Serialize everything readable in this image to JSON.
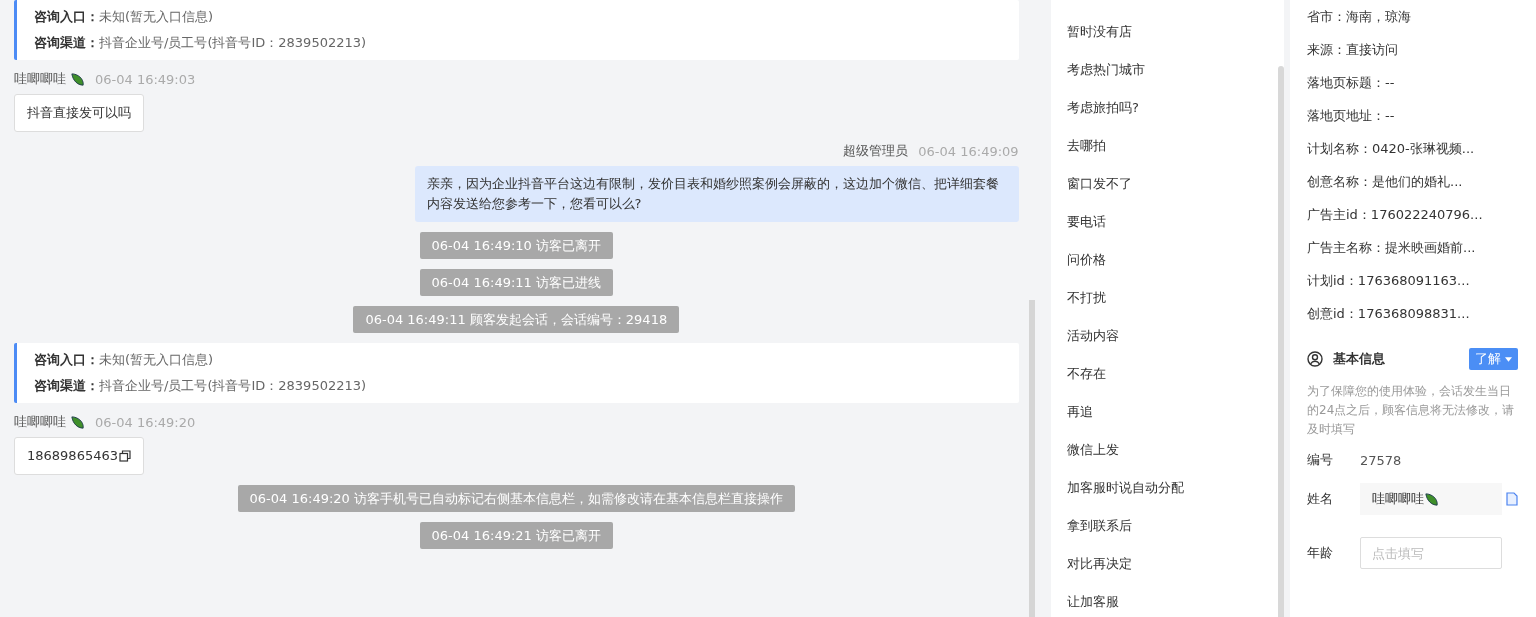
{
  "messages": [
    {
      "kind": "info_card",
      "rows": [
        {
          "label": "咨询入口：",
          "value": "未知(暂无入口信息)"
        },
        {
          "label": "咨询渠道：",
          "value": "抖音企业号/员工号(抖音号ID：2839502213)"
        }
      ]
    },
    {
      "kind": "visitor",
      "sender": "哇唧唧哇",
      "time": "06-04 16:49:03",
      "text": "抖音直接发可以吗",
      "copyable": false
    },
    {
      "kind": "agent",
      "sender": "超级管理员",
      "time": "06-04 16:49:09",
      "text": "亲亲，因为企业抖音平台这边有限制，发价目表和婚纱照案例会屏蔽的，这边加个微信、把详细套餐内容发送给您参考一下，您看可以么?"
    },
    {
      "kind": "system",
      "text": "06-04 16:49:10 访客已离开"
    },
    {
      "kind": "system",
      "text": "06-04 16:49:11 访客已进线"
    },
    {
      "kind": "system",
      "text": "06-04 16:49:11 顾客发起会话，会话编号：29418"
    },
    {
      "kind": "info_card",
      "rows": [
        {
          "label": "咨询入口：",
          "value": "未知(暂无入口信息)"
        },
        {
          "label": "咨询渠道：",
          "value": "抖音企业号/员工号(抖音号ID：2839502213)"
        }
      ]
    },
    {
      "kind": "visitor",
      "sender": "哇唧唧哇",
      "time": "06-04 16:49:20",
      "text": "18689865463",
      "copyable": true
    },
    {
      "kind": "system",
      "text": "06-04 16:49:20 访客手机号已自动标记右侧基本信息栏，如需修改请在基本信息栏直接操作"
    },
    {
      "kind": "system",
      "text": "06-04 16:49:21 访客已离开"
    }
  ],
  "quick_replies": [
    "暂时没有店",
    "考虑热门城市",
    "考虑旅拍吗?",
    "去哪拍",
    "窗口发不了",
    "要电话",
    "问价格",
    "不打扰",
    "活动内容",
    "不存在",
    "再追",
    "微信上发",
    "加客服时说自动分配",
    "拿到联系后",
    "对比再决定",
    "让加客服"
  ],
  "visitor_info": [
    "省市：海南，琼海",
    "来源：直接访问",
    "落地页标题：--",
    "落地页地址：--",
    "计划名称：0420-张琳视频...",
    "创意名称：是他们的婚礼...",
    "广告主id：176022240796...",
    "广告主名称：提米映画婚前...",
    "计划id：176368091163...",
    "创意id：176368098831..."
  ],
  "basic_info": {
    "title": "基本信息",
    "learn_button": "了解",
    "notice": "为了保障您的使用体验，会话发生当日的24点之后，顾客信息将无法修改，请及时填写",
    "fields": [
      {
        "kind": "text",
        "label": "编号",
        "value": "27578"
      },
      {
        "kind": "name",
        "label": "姓名",
        "value": "哇唧唧哇"
      },
      {
        "kind": "input",
        "label": "年龄",
        "placeholder": "点击填写"
      }
    ]
  }
}
